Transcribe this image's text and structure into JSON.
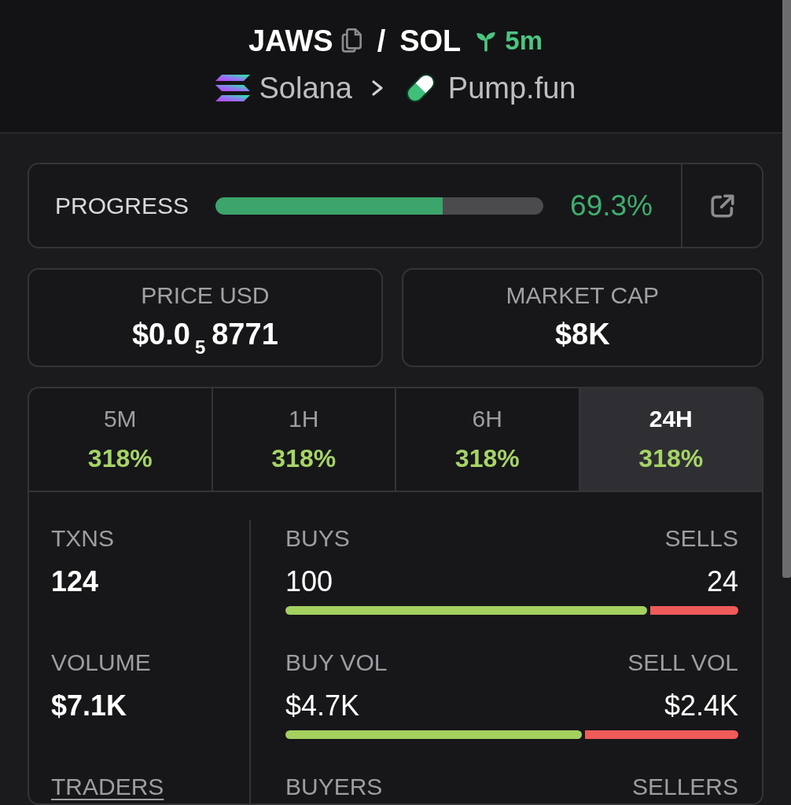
{
  "header": {
    "base_symbol": "JAWS",
    "separator": "/",
    "quote_symbol": "SOL",
    "age": "5m",
    "chain": "Solana",
    "dex": "Pump.fun"
  },
  "progress": {
    "label": "PROGRESS",
    "level": 0.693,
    "reading": "69.3%"
  },
  "stats": [
    {
      "label": "PRICE USD",
      "value": "$0.0$_{5}$8771"
    },
    {
      "label": "MARKET CAP",
      "value": "$8K"
    }
  ],
  "timeframes": [
    {
      "label": "5M",
      "change": "318%",
      "selected": false
    },
    {
      "label": "1H",
      "change": "318%",
      "selected": false
    },
    {
      "label": "6H",
      "change": "318%",
      "selected": false
    },
    {
      "label": "24H",
      "change": "318%",
      "selected": true
    }
  ],
  "activity": {
    "metrics": [
      {
        "kind": "plain",
        "label": "TXNS",
        "value": "124"
      },
      {
        "kind": "plain",
        "label": "VOLUME",
        "value": "$7.1K"
      },
      {
        "kind": "link",
        "label": "TRADERS"
      }
    ],
    "splits": [
      {
        "left_label": "BUYS",
        "right_label": "SELLS",
        "left_value": "100",
        "right_value": "24",
        "level": 0.806
      },
      {
        "left_label": "BUY VOL",
        "right_label": "SELL VOL",
        "left_value": "$4.7K",
        "right_value": "$2.4K",
        "level": 0.662
      },
      {
        "left_label": "BUYERS",
        "right_label": "SELLERS"
      }
    ]
  }
}
